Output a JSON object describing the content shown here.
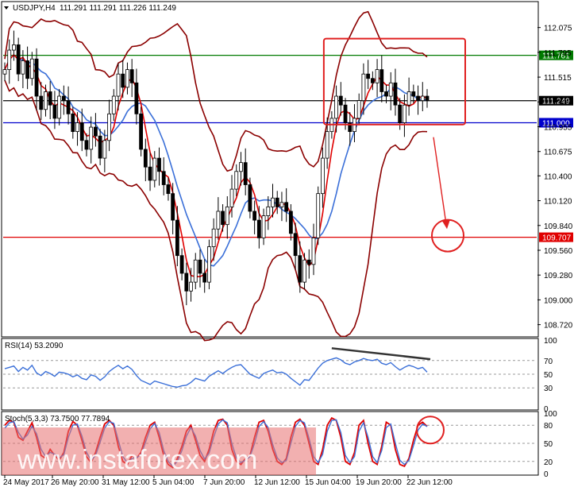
{
  "chart_data": [
    {
      "type": "candlestick",
      "panel": "main",
      "symbol_label": "USDJPY,H4",
      "ohlc_label": "111.291 111.291 111.226 111.249",
      "ylim": [
        108.6,
        112.35
      ],
      "y_ticks": [
        "112.075",
        "111.795",
        "111.515",
        "111.235",
        "110.955",
        "110.675",
        "110.400",
        "110.120",
        "109.840",
        "109.560",
        "109.280",
        "109.000",
        "108.720"
      ],
      "y_tick_values": [
        112.075,
        111.795,
        111.515,
        111.235,
        110.955,
        110.675,
        110.4,
        110.12,
        109.84,
        109.56,
        109.28,
        109.0,
        108.72
      ],
      "x_ticks": [
        "24 May 2017",
        "26 May 20:00",
        "31 May 12:00",
        "5 Jun 04:00",
        "7 Jun 20:00",
        "12 Jun 12:00",
        "15 Jun 04:00",
        "19 Jun 20:00",
        "22 Jun 12:00"
      ],
      "levels": [
        {
          "label": "111.761",
          "value": 111.761,
          "color": "#007a00"
        },
        {
          "label": "111.249",
          "value": 111.249,
          "color": "#000000"
        },
        {
          "label": "111.000",
          "value": 111.0,
          "color": "#0000cc"
        },
        {
          "label": "109.707",
          "value": 109.707,
          "color": "#e00000"
        }
      ],
      "closes": [
        111.6,
        111.82,
        111.88,
        111.55,
        111.7,
        111.5,
        111.72,
        111.3,
        111.15,
        111.35,
        111.2,
        111.05,
        111.3,
        111.25,
        111.1,
        110.9,
        111.0,
        110.8,
        110.7,
        110.95,
        110.85,
        110.6,
        110.8,
        111.1,
        111.3,
        111.55,
        111.4,
        111.6,
        111.45,
        111.1,
        110.7,
        110.5,
        110.35,
        110.6,
        110.45,
        110.3,
        110.2,
        109.9,
        109.5,
        109.3,
        109.1,
        109.2,
        109.45,
        109.3,
        109.2,
        109.6,
        109.8,
        110.0,
        109.85,
        110.05,
        110.25,
        110.45,
        110.55,
        110.3,
        110.0,
        109.9,
        109.7,
        109.95,
        110.05,
        110.15,
        110.05,
        110.1,
        110.0,
        109.75,
        109.5,
        109.2,
        109.45,
        109.4,
        109.7,
        110.2,
        110.6,
        110.9,
        111.05,
        111.3,
        111.2,
        111.0,
        110.9,
        111.05,
        111.25,
        111.55,
        111.5,
        111.45,
        111.6,
        111.35,
        111.3,
        111.45,
        111.2,
        111.0,
        111.2,
        111.35,
        111.3,
        111.25,
        111.3,
        111.249
      ],
      "bollinger": {
        "color": "#8b0000"
      },
      "ma_fast": {
        "color": "#e00000"
      },
      "ma_slow": {
        "color": "#3a6fd8"
      },
      "annotations": [
        {
          "kind": "rectangle",
          "color": "#e02020"
        },
        {
          "kind": "arrow",
          "color": "#e02020"
        },
        {
          "kind": "circle",
          "color": "#e02020"
        }
      ]
    },
    {
      "type": "line",
      "panel": "rsi",
      "label": "RSI(14) 53.2090",
      "ylim": [
        0,
        100
      ],
      "y_ticks": [
        "100",
        "70",
        "50",
        "30",
        "0"
      ],
      "y_tick_values": [
        100,
        70,
        50,
        30,
        0
      ],
      "levels": [
        70,
        50,
        30
      ],
      "values": [
        58,
        60,
        62,
        54,
        60,
        56,
        63,
        52,
        48,
        54,
        51,
        47,
        53,
        52,
        50,
        46,
        49,
        44,
        42,
        49,
        47,
        41,
        46,
        54,
        59,
        63,
        58,
        62,
        57,
        48,
        41,
        38,
        35,
        40,
        38,
        36,
        34,
        32,
        31,
        33,
        34,
        38,
        44,
        42,
        40,
        47,
        51,
        55,
        51,
        56,
        60,
        63,
        64,
        57,
        50,
        47,
        44,
        51,
        54,
        56,
        52,
        53,
        50,
        44,
        39,
        34,
        42,
        41,
        50,
        59,
        66,
        70,
        72,
        74,
        71,
        66,
        64,
        68,
        70,
        73,
        71,
        70,
        72,
        66,
        64,
        67,
        61,
        56,
        60,
        63,
        61,
        58,
        60,
        53
      ],
      "divergence_color": "#333333",
      "color": "#3a6fd8"
    },
    {
      "type": "line",
      "panel": "stochastic",
      "label": "Stoch(5,3,3) 73.7500 77.7894",
      "ylim": [
        0,
        100
      ],
      "y_ticks": [
        "100",
        "80",
        "50",
        "20",
        "0"
      ],
      "y_tick_values": [
        100,
        80,
        50,
        20,
        0
      ],
      "levels": [
        80,
        50,
        20
      ],
      "series": [
        {
          "name": "",
          "color": "#e00000",
          "values": [
            80,
            88,
            85,
            60,
            55,
            70,
            84,
            60,
            30,
            25,
            40,
            30,
            22,
            35,
            70,
            86,
            80,
            55,
            28,
            18,
            35,
            60,
            82,
            88,
            80,
            45,
            20,
            15,
            30,
            25,
            35,
            60,
            80,
            85,
            60,
            30,
            15,
            10,
            25,
            45,
            70,
            80,
            55,
            30,
            20,
            40,
            70,
            88,
            90,
            80,
            40,
            20,
            15,
            25,
            30,
            60,
            85,
            88,
            70,
            40,
            20,
            15,
            25,
            60,
            85,
            90,
            80,
            50,
            20,
            15,
            40,
            80,
            92,
            88,
            60,
            20,
            15,
            35,
            80,
            88,
            50,
            20,
            15,
            45,
            85,
            80,
            40,
            15,
            12,
            25,
            55,
            80,
            85,
            78
          ]
        },
        {
          "name": "",
          "color": "#3a6fd8",
          "values": [
            75,
            84,
            86,
            68,
            57,
            64,
            78,
            66,
            40,
            28,
            35,
            32,
            26,
            31,
            60,
            80,
            82,
            62,
            35,
            22,
            30,
            52,
            75,
            86,
            83,
            55,
            28,
            18,
            25,
            26,
            31,
            52,
            74,
            83,
            68,
            38,
            20,
            12,
            20,
            38,
            62,
            76,
            62,
            38,
            24,
            34,
            60,
            82,
            89,
            84,
            50,
            26,
            18,
            22,
            28,
            50,
            78,
            86,
            76,
            48,
            26,
            18,
            22,
            50,
            78,
            88,
            84,
            58,
            28,
            18,
            32,
            70,
            88,
            89,
            68,
            30,
            18,
            28,
            70,
            84,
            60,
            28,
            18,
            38,
            76,
            82,
            50,
            22,
            15,
            22,
            46,
            72,
            82,
            77.79
          ]
        }
      ]
    }
  ],
  "watermark": {
    "text": "www.instaforex.com"
  }
}
